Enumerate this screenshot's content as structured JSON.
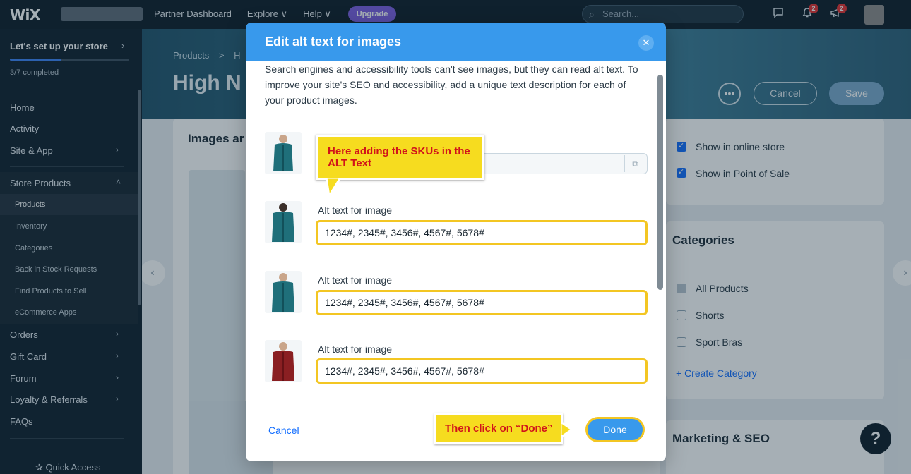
{
  "topbar": {
    "logo": "WiX",
    "nav": [
      "Partner Dashboard",
      "Explore ∨",
      "Help ∨"
    ],
    "upgrade_label": "Upgrade",
    "search_placeholder": "Search...",
    "notif_badge": "2",
    "updates_badge": "2"
  },
  "sidebar": {
    "setup_title": "Let's set up your store",
    "completed_text": "3/7 completed",
    "progress_fraction": 0.43,
    "items": {
      "home": "Home",
      "activity": "Activity",
      "site_app": "Site & App",
      "store_products": "Store Products",
      "orders": "Orders",
      "gift_card": "Gift Card",
      "forum": "Forum",
      "loyalty": "Loyalty & Referrals",
      "faqs": "FAQs"
    },
    "sub_items": {
      "products": "Products",
      "inventory": "Inventory",
      "categories": "Categories",
      "back_in_stock": "Back in Stock Requests",
      "find_products": "Find Products to Sell",
      "ecommerce_apps": "eCommerce Apps"
    },
    "quick_access": "Quick Access"
  },
  "page": {
    "breadcrumb_root": "Products",
    "breadcrumb_sep": ">",
    "breadcrumb_current": "H",
    "title_partial": "High N",
    "cancel_label": "Cancel",
    "save_label": "Save",
    "images_card_title_partial": "Images ar",
    "visibility": {
      "show_online": "Show in online store",
      "show_pos": "Show in Point of Sale"
    },
    "categories": {
      "title": "Categories",
      "options": [
        "All Products",
        "Shorts",
        "Sport Bras"
      ],
      "create_link": "+ Create Category"
    },
    "marketing_title": "Marketing & SEO",
    "help_label": "?"
  },
  "modal": {
    "title": "Edit alt text for images",
    "description": "Search engines and accessibility tools can't see images, but they can read alt text. To improve your site's SEO and accessibility, add a unique text description for each of your product images.",
    "rows": [
      {
        "label": "Alt text for image",
        "value": "1234#, 2345#, 3456#, 4567#, 5678#"
      },
      {
        "label": "Alt text for image",
        "value": "1234#, 2345#, 3456#, 4567#, 5678#"
      },
      {
        "label": "Alt text for image",
        "value": "1234#, 2345#, 3456#, 4567#, 5678#"
      }
    ],
    "cancel_label": "Cancel",
    "done_label": "Done"
  },
  "callouts": {
    "sku_note": "Here adding the SKUs in the ALT Text",
    "done_note": "Then click on “Done”"
  },
  "colors": {
    "accent": "#3899ec",
    "highlight": "#f3c623",
    "callout_bg": "#f6dc1f",
    "callout_text": "#d1141a"
  }
}
